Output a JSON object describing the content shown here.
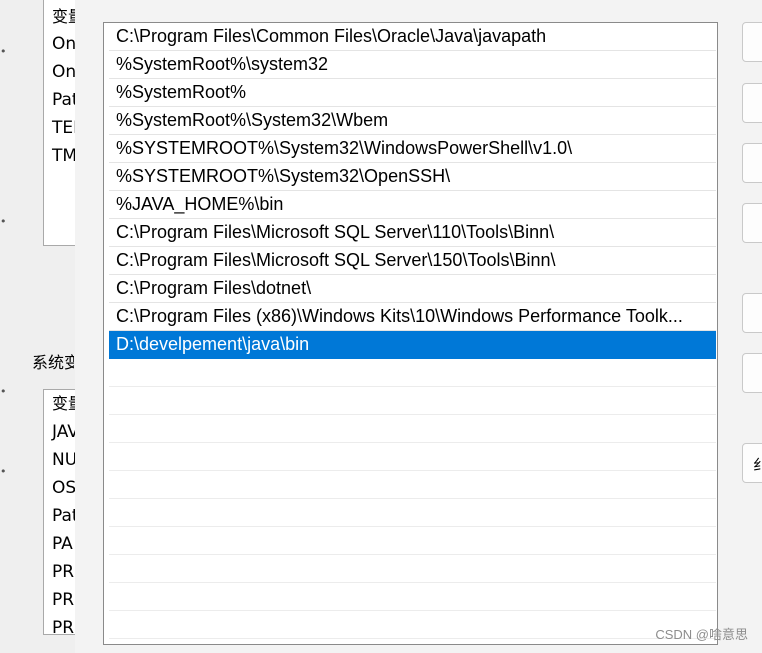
{
  "background_window": {
    "user_vars": {
      "header": "变量",
      "rows": [
        "On",
        "On",
        "Pat",
        "TEI",
        "TM"
      ]
    },
    "system_group_label": "系统变",
    "system_vars": {
      "header": "变量",
      "rows": [
        "JAV",
        "NU",
        "OS",
        "Pat",
        "PA",
        "PR",
        "PR",
        "PR"
      ]
    }
  },
  "edit_dialog": {
    "path_entries": [
      "C:\\Program Files\\Common Files\\Oracle\\Java\\javapath",
      "%SystemRoot%\\system32",
      "%SystemRoot%",
      "%SystemRoot%\\System32\\Wbem",
      "%SYSTEMROOT%\\System32\\WindowsPowerShell\\v1.0\\",
      "%SYSTEMROOT%\\System32\\OpenSSH\\",
      "%JAVA_HOME%\\bin",
      "C:\\Program Files\\Microsoft SQL Server\\110\\Tools\\Binn\\",
      "C:\\Program Files\\Microsoft SQL Server\\150\\Tools\\Binn\\",
      "C:\\Program Files\\dotnet\\",
      "C:\\Program Files (x86)\\Windows Kits\\10\\Windows Performance Toolk...",
      "D:\\develpement\\java\\bin"
    ],
    "selected_entry": "D:\\develpement\\java\\bin",
    "partial_button_label": "纟"
  },
  "watermark": "CSDN @啥意思",
  "colors": {
    "selection": "#0078d7",
    "selection_text": "#ffffff"
  }
}
